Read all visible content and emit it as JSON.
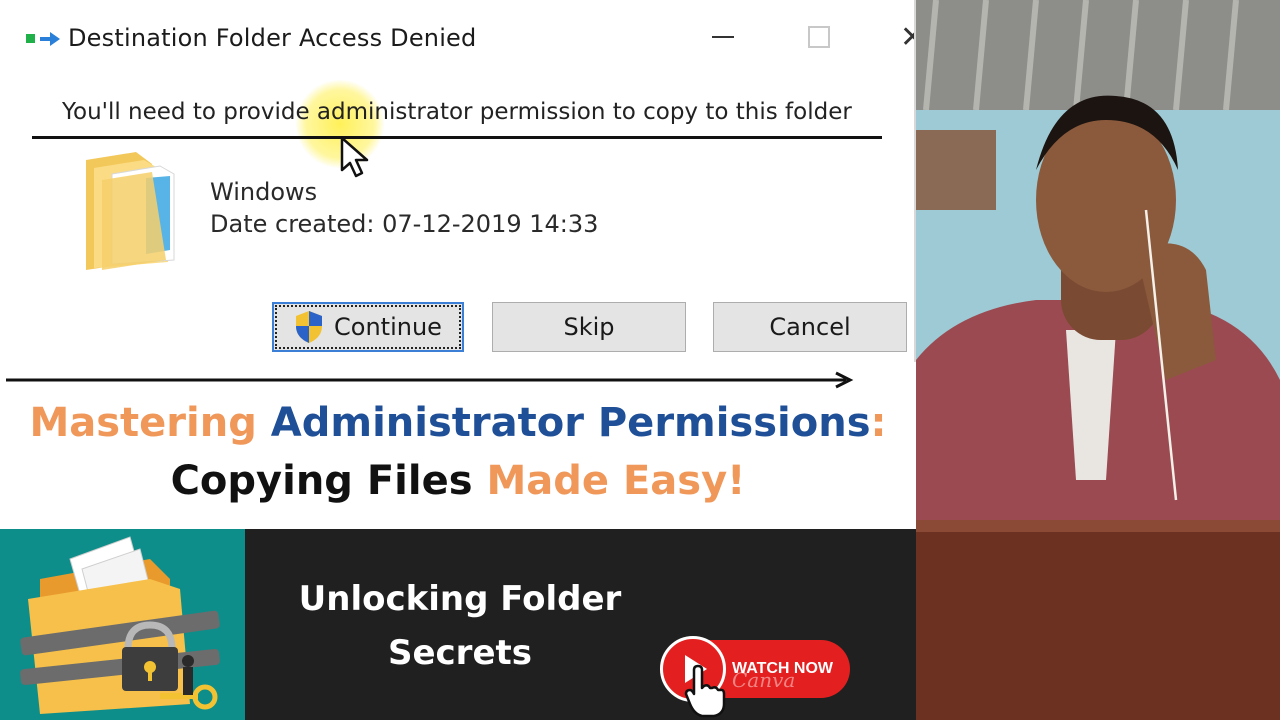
{
  "dialog": {
    "title": "Destination Folder Access Denied",
    "message": "You'll need to provide administrator permission to copy to this folder",
    "item_name": "Windows",
    "item_date": "Date created: 07-12-2019 14:33",
    "buttons": {
      "continue": "Continue",
      "skip": "Skip",
      "cancel": "Cancel"
    }
  },
  "headline": {
    "line1_part1": "Mastering",
    "line1_part2": "Administrator Permissions",
    "line1_part3": ":",
    "line2_part1": "Copying Files",
    "line2_part2": "Made Easy!"
  },
  "banner": {
    "subtitle_line1": "Unlocking Folder",
    "subtitle_line2": "Secrets",
    "watch_label": "WATCH NOW",
    "watch_brand": "Canva"
  },
  "colors": {
    "orange": "#f0975a",
    "blue": "#1f4f97",
    "teal": "#0e8e8a",
    "dark": "#202020",
    "red": "#e3201f"
  },
  "icons": [
    "app-icon",
    "folder-icon",
    "shield-icon",
    "cursor-icon",
    "locked-folder-icon",
    "play-icon",
    "hand-pointer-icon"
  ]
}
